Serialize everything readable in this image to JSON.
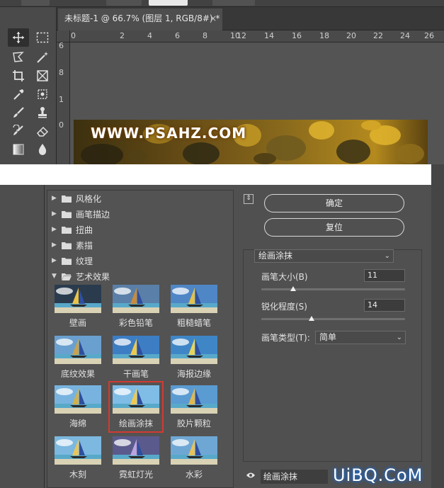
{
  "document_tab": {
    "title": "未标题-1 @ 66.7% (图层 1, RGB/8#) *",
    "close_glyph": "×"
  },
  "ruler": {
    "top_labels": [
      "0",
      "2",
      "4",
      "6",
      "8",
      "10",
      "12",
      "14",
      "16",
      "18",
      "20",
      "22",
      "24",
      "26"
    ],
    "left_labels": [
      "6",
      "8",
      "1",
      "0"
    ]
  },
  "canvas": {
    "photo_text": "WWW.PSAHZ.COM"
  },
  "filter_gallery": {
    "folders": [
      {
        "label": "风格化",
        "expanded": false
      },
      {
        "label": "画笔描边",
        "expanded": false
      },
      {
        "label": "扭曲",
        "expanded": false
      },
      {
        "label": "素描",
        "expanded": false
      },
      {
        "label": "纹理",
        "expanded": false
      },
      {
        "label": "艺术效果",
        "expanded": true
      }
    ],
    "thumbnails": [
      {
        "label": "壁画"
      },
      {
        "label": "彩色铅笔"
      },
      {
        "label": "粗糙蜡笔"
      },
      {
        "label": "底纹效果"
      },
      {
        "label": "干画笔"
      },
      {
        "label": "海报边缘"
      },
      {
        "label": "海绵"
      },
      {
        "label": "绘画涂抹",
        "selected": true
      },
      {
        "label": "胶片颗粒"
      },
      {
        "label": "木刻"
      },
      {
        "label": "霓虹灯光"
      },
      {
        "label": "水彩"
      }
    ]
  },
  "panel": {
    "ok_label": "确定",
    "reset_label": "复位",
    "filter_select": "绘画涂抹",
    "brush_size_label": "画笔大小(B)",
    "brush_size_value": "11",
    "brush_size_fraction": 0.22,
    "sharpness_label": "锐化程度(S)",
    "sharpness_value": "14",
    "sharpness_fraction": 0.35,
    "brush_type_label": "画笔类型(T):",
    "brush_type_value": "简单",
    "layer_name": "绘画涂抹"
  },
  "watermark": "UiBQ.CoM",
  "colors": {
    "selection_border": "#d23a32",
    "watermark_glow": "#1b6bd0"
  }
}
